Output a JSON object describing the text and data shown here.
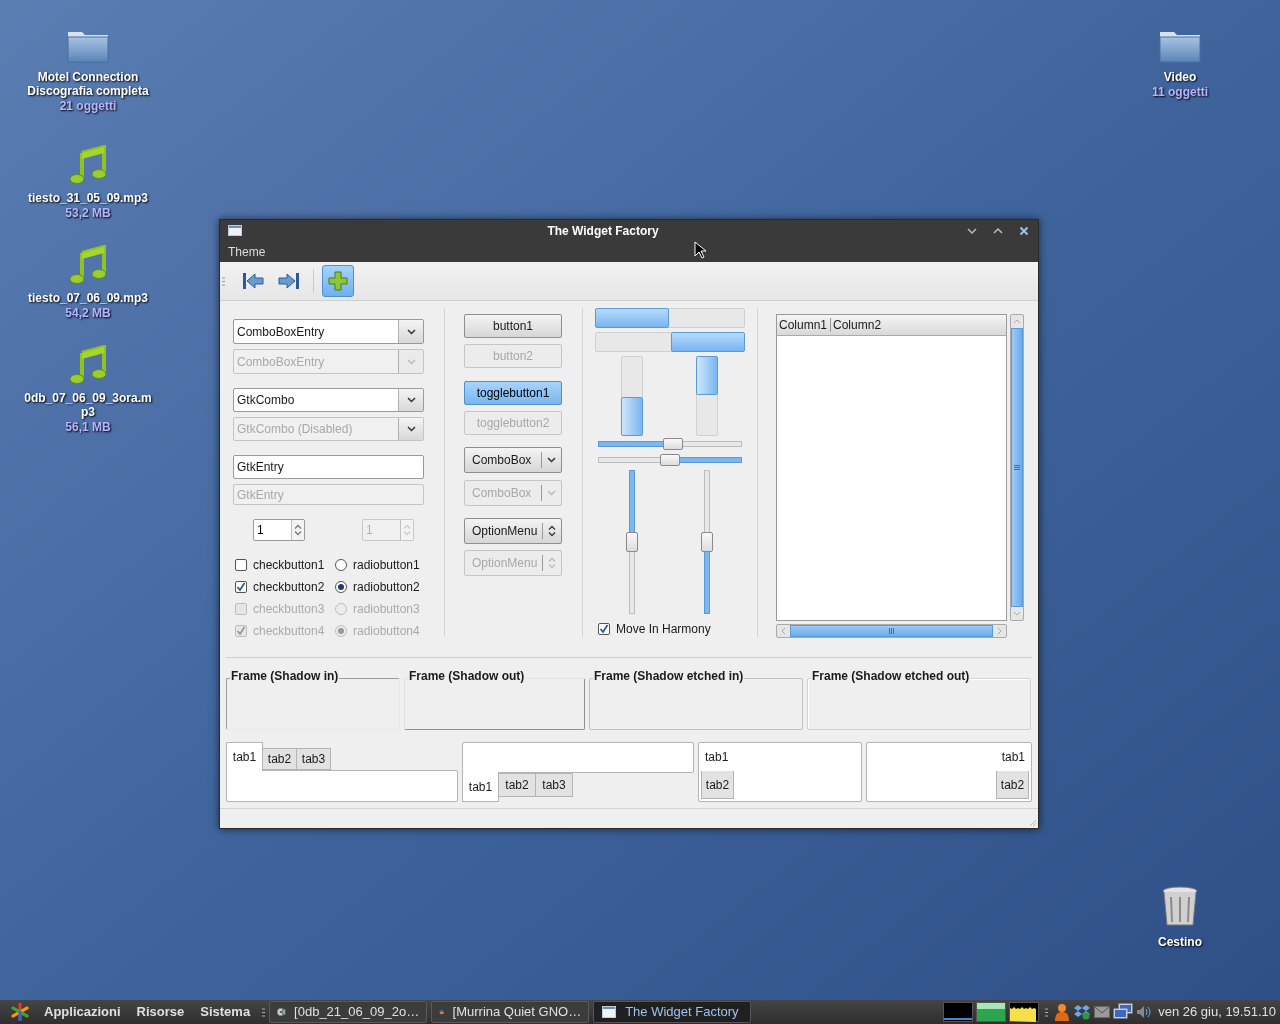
{
  "desktop_icons": [
    {
      "kind": "folder",
      "name": "Motel Connection Discografia completa",
      "detail": "21 oggetti"
    },
    {
      "kind": "music",
      "name": "tiesto_31_05_09.mp3",
      "detail": "53,2 MB"
    },
    {
      "kind": "music",
      "name": "tiesto_07_06_09.mp3",
      "detail": "54,2 MB"
    },
    {
      "kind": "music",
      "name": "0db_07_06_09_3ora.mp3",
      "detail": "56,1 MB"
    },
    {
      "kind": "folder",
      "name": "Video",
      "detail": "11 oggetti"
    },
    {
      "kind": "trash",
      "name": "Cestino"
    }
  ],
  "window": {
    "title": "The Widget Factory",
    "menu": [
      "Theme"
    ],
    "toolbar": [
      {
        "kind": "first",
        "pressed": false
      },
      {
        "kind": "last",
        "pressed": false
      },
      {
        "kind": "add",
        "pressed": true
      }
    ],
    "left_column": [
      {
        "kind": "combo_entry",
        "value": "ComboBoxEntry",
        "disabled": false
      },
      {
        "kind": "combo_entry",
        "value": "ComboBoxEntry",
        "disabled": true
      },
      {
        "kind": "combo",
        "value": "GtkCombo",
        "disabled": false
      },
      {
        "kind": "combo",
        "value": "GtkCombo (Disabled)",
        "disabled": true
      },
      {
        "kind": "entry",
        "value": "GtkEntry",
        "disabled": false
      },
      {
        "kind": "entry",
        "value": "GtkEntry",
        "disabled": true
      }
    ],
    "spin_buttons": [
      {
        "value": "1",
        "disabled": false
      },
      {
        "value": "1",
        "disabled": true
      }
    ],
    "check_buttons": [
      {
        "label": "checkbutton1",
        "checked": false,
        "disabled": false
      },
      {
        "label": "checkbutton2",
        "checked": true,
        "disabled": false
      },
      {
        "label": "checkbutton3",
        "checked": false,
        "disabled": true
      },
      {
        "label": "checkbutton4",
        "checked": true,
        "disabled": true
      }
    ],
    "radio_buttons": [
      {
        "label": "radiobutton1",
        "selected": false,
        "disabled": false
      },
      {
        "label": "radiobutton2",
        "selected": true,
        "disabled": false
      },
      {
        "label": "radiobutton3",
        "selected": false,
        "disabled": true
      },
      {
        "label": "radiobutton4",
        "selected": true,
        "disabled": true
      }
    ],
    "buttons": [
      {
        "kind": "button",
        "label": "button1",
        "disabled": false,
        "pressed": false
      },
      {
        "kind": "button",
        "label": "button2",
        "disabled": true,
        "pressed": false
      },
      {
        "kind": "toggle",
        "label": "togglebutton1",
        "disabled": false,
        "pressed": true
      },
      {
        "kind": "toggle",
        "label": "togglebutton2",
        "disabled": true,
        "pressed": false
      },
      {
        "kind": "combobox",
        "label": "ComboBox",
        "disabled": false,
        "pressed": false
      },
      {
        "kind": "combobox",
        "label": "ComboBox",
        "disabled": true,
        "pressed": false
      },
      {
        "kind": "optionmenu",
        "label": "OptionMenu",
        "disabled": false,
        "pressed": false
      },
      {
        "kind": "optionmenu",
        "label": "OptionMenu",
        "disabled": true,
        "pressed": false
      }
    ],
    "progress_bars": [
      {
        "kind": "horizontal",
        "inverted": false,
        "level": 0.5
      },
      {
        "kind": "horizontal",
        "inverted": true,
        "level": 0.5
      },
      {
        "kind": "vertical",
        "inverted": true,
        "level": 0.5
      },
      {
        "kind": "vertical",
        "inverted": false,
        "level": 0.5
      }
    ],
    "scales": [
      {
        "kind": "horizontal",
        "inverted": false,
        "level": 0.52
      },
      {
        "kind": "horizontal",
        "inverted": true,
        "level": 0.5
      },
      {
        "kind": "vertical",
        "inverted": false,
        "level": 0.5
      },
      {
        "kind": "vertical",
        "inverted": true,
        "level": 0.5
      }
    ],
    "harmony": {
      "label": "Move In Harmony",
      "checked": true
    },
    "tree": {
      "columns": [
        "Column1",
        "Column2"
      ]
    },
    "frames": [
      {
        "label": "Frame (Shadow in)",
        "kind": "in"
      },
      {
        "label": "Frame (Shadow out)",
        "kind": "out"
      },
      {
        "label": "Frame (Shadow etched in)",
        "kind": "etched_in"
      },
      {
        "label": "Frame (Shadow etched out)",
        "kind": "etched_out"
      }
    ],
    "notebooks": [
      {
        "kind": "top",
        "tabs": [
          {
            "label": "tab1",
            "selected": true
          },
          {
            "label": "tab2",
            "selected": false
          },
          {
            "label": "tab3",
            "selected": false
          }
        ]
      },
      {
        "kind": "bottom",
        "tabs": [
          {
            "label": "tab1",
            "selected": true
          },
          {
            "label": "tab2",
            "selected": false
          },
          {
            "label": "tab3",
            "selected": false
          }
        ]
      },
      {
        "kind": "left",
        "tabs": [
          {
            "label": "tab1",
            "selected": true
          },
          {
            "label": "tab2",
            "selected": false
          }
        ]
      },
      {
        "kind": "right",
        "tabs": [
          {
            "label": "tab1",
            "selected": true
          },
          {
            "label": "tab2",
            "selected": false
          }
        ]
      }
    ]
  },
  "taskbar": {
    "menus": [
      "Applicazioni",
      "Risorse",
      "Sistema"
    ],
    "tasks": [
      {
        "kind": "media",
        "label": "[0db_21_06_09_2o…",
        "selected": false
      },
      {
        "kind": "browser",
        "label": "[Murrina Quiet GNO…",
        "selected": false
      },
      {
        "kind": "window",
        "label": "The Widget Factory",
        "selected": true
      }
    ],
    "clock": "ven 26 giu, 19.51.10"
  }
}
